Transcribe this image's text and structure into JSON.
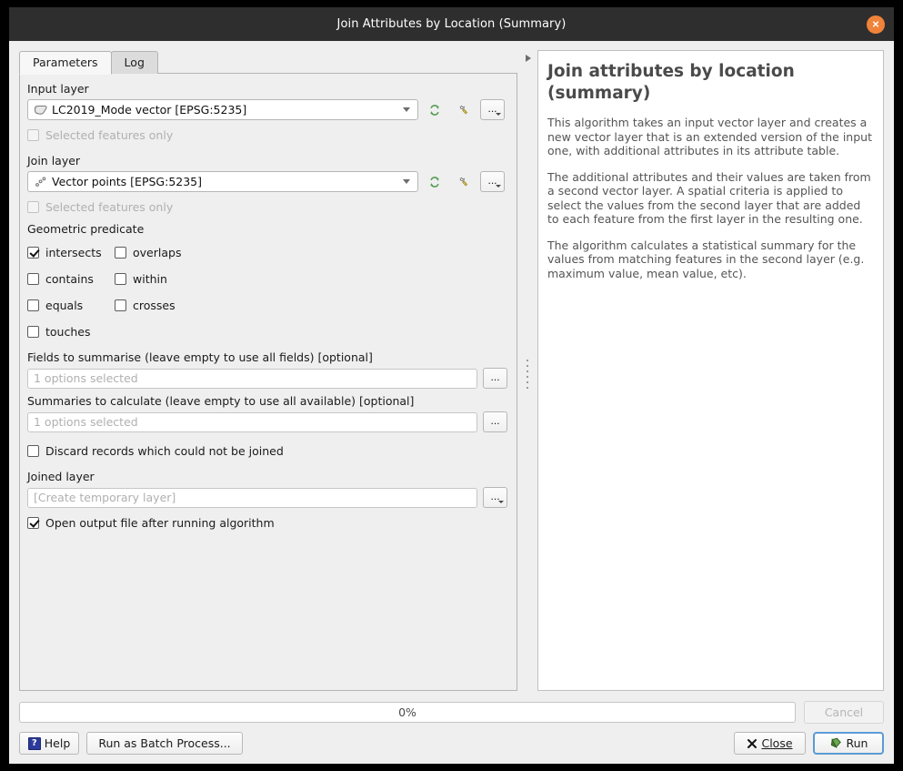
{
  "window": {
    "title": "Join Attributes by Location (Summary)",
    "close_icon": "close-icon"
  },
  "tabs": [
    {
      "label": "Parameters",
      "active": true
    },
    {
      "label": "Log",
      "active": false
    }
  ],
  "parameters": {
    "input_layer": {
      "label": "Input layer",
      "value": "LC2019_Mode vector [EPSG:5235]",
      "icon": "polygon-layer-icon",
      "selected_only_label": "Selected features only",
      "selected_only_checked": false,
      "selected_only_disabled": true
    },
    "join_layer": {
      "label": "Join layer",
      "value": "Vector points [EPSG:5235]",
      "icon": "point-layer-icon",
      "selected_only_label": "Selected features only",
      "selected_only_checked": false,
      "selected_only_disabled": true
    },
    "geometric_predicate": {
      "label": "Geometric predicate",
      "options": [
        {
          "label": "intersects",
          "checked": true
        },
        {
          "label": "overlaps",
          "checked": false
        },
        {
          "label": "contains",
          "checked": false
        },
        {
          "label": "within",
          "checked": false
        },
        {
          "label": "equals",
          "checked": false
        },
        {
          "label": "crosses",
          "checked": false
        },
        {
          "label": "touches",
          "checked": false
        }
      ]
    },
    "fields_to_summarise": {
      "label": "Fields to summarise (leave empty to use all fields) [optional]",
      "value": "1 options selected",
      "browse_label": "..."
    },
    "summaries_to_calculate": {
      "label": "Summaries to calculate (leave empty to use all available) [optional]",
      "value": "1 options selected",
      "browse_label": "..."
    },
    "discard_records": {
      "label": "Discard records which could not be joined",
      "checked": false
    },
    "joined_layer": {
      "label": "Joined layer",
      "value": "[Create temporary layer]",
      "browse_label": "..."
    },
    "open_output": {
      "label": "Open output file after running algorithm",
      "checked": true
    },
    "buttons": {
      "refresh_label": "refresh-icon",
      "wrench_label": "wrench-icon",
      "dots_label": "..."
    }
  },
  "help": {
    "title": "Join attributes by location (summary)",
    "paragraphs": [
      "This algorithm takes an input vector layer and creates a new vector layer that is an extended version of the input one, with additional attributes in its attribute table.",
      "The additional attributes and their values are taken from a second vector layer. A spatial criteria is applied to select the values from the second layer that are added to each feature from the first layer in the resulting one.",
      "The algorithm calculates a statistical summary for the values from matching features in the second layer (e.g. maximum value, mean value, etc)."
    ]
  },
  "footer": {
    "progress_text": "0%",
    "progress_percent": 0,
    "cancel_label": "Cancel",
    "help_label": "Help",
    "batch_label": "Run as Batch Process...",
    "close_label": "Close",
    "run_label": "Run"
  },
  "colors": {
    "titlebar": "#2e2e2e",
    "close_button": "#f0833a",
    "accent_focus": "#5b9bd5",
    "refresh_green": "#4e9a4e",
    "help_blue": "#2b3a9c"
  }
}
